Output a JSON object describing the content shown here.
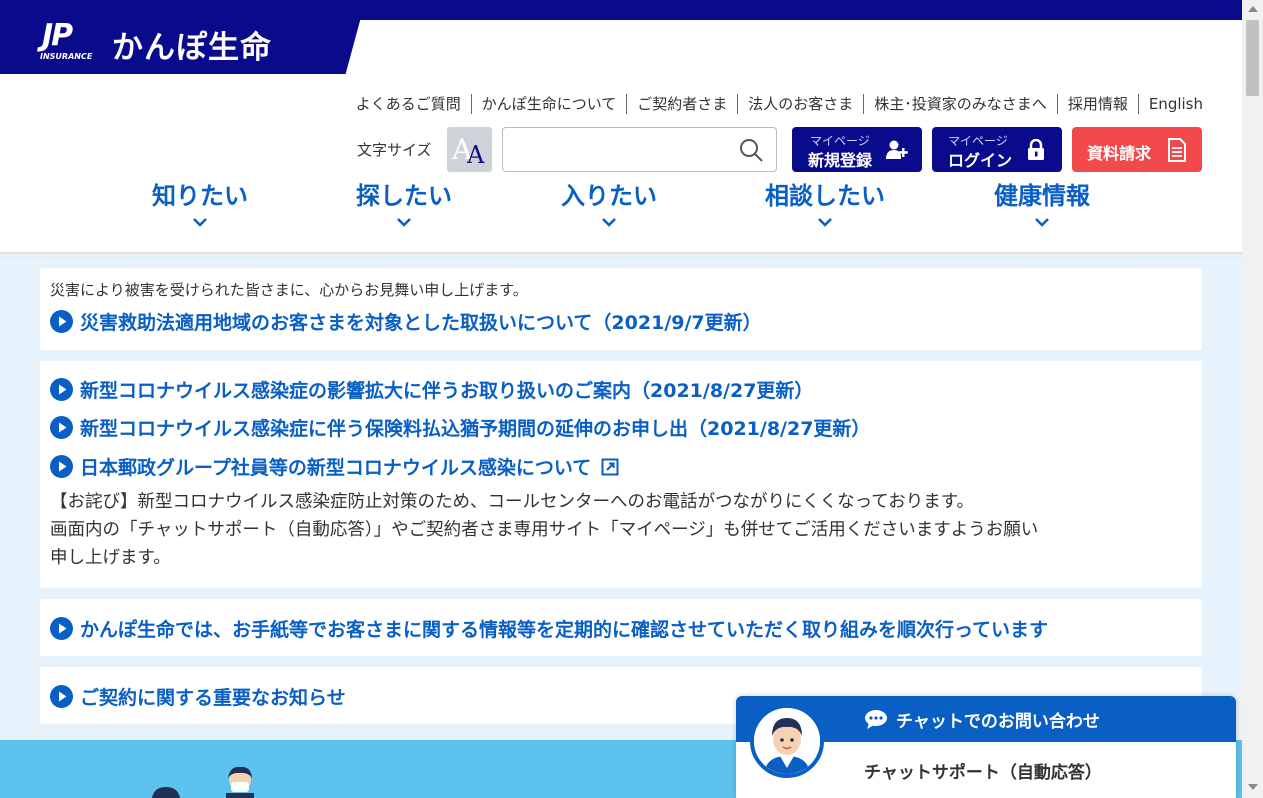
{
  "brand": {
    "logo_jp": "JP",
    "logo_sub": "INSURANCE",
    "name": "かんぽ生命"
  },
  "util_nav": [
    "よくあるご質問",
    "かんぽ生命について",
    "ご契約者さま",
    "法人のお客さま",
    "株主･投資家のみなさまへ",
    "採用情報",
    "English"
  ],
  "tools": {
    "font_size_label": "文字サイズ",
    "search_placeholder": "",
    "mypage_register_small": "マイページ",
    "mypage_register_main": "新規登録",
    "mypage_login_small": "マイページ",
    "mypage_login_main": "ログイン",
    "request_docs": "資料請求"
  },
  "main_nav": [
    "知りたい",
    "探したい",
    "入りたい",
    "相談したい",
    "健康情報"
  ],
  "notices": {
    "disaster_text": "災害により被害を受けられた皆さまに、心からお見舞い申し上げます。",
    "disaster_link": "災害救助法適用地域のお客さまを対象とした取扱いについて（2021/9/7更新）",
    "covid_link_1": "新型コロナウイルス感染症の影響拡大に伴うお取り扱いのご案内（2021/8/27更新）",
    "covid_link_2": "新型コロナウイルス感染症に伴う保険料払込猶予期間の延伸のお申し出（2021/8/27更新）",
    "covid_link_3": "日本郵政グループ社員等の新型コロナウイルス感染について",
    "apology_line_1": "【お詫び】新型コロナウイルス感染症防止対策のため、コールセンターへのお電話がつながりにくくなっております。",
    "apology_line_2": "画面内の「チャットサポート（自動応答）」やご契約者さま専用サイト「マイページ」も併せてご活用くださいますようお願い",
    "apology_line_3": "申し上げます。",
    "confirm_link": "かんぽ生命では、お手紙等でお客さまに関する情報等を定期的に確認させていただく取り組みを順次行っています",
    "important_link": "ご契約に関する重要なお知らせ"
  },
  "chat": {
    "title": "チャットでのお問い合わせ",
    "support": "チャットサポート（自動応答）"
  },
  "colors": {
    "brand_navy": "#0a0a8c",
    "link_blue": "#0a5fc4",
    "request_red": "#f24a4a",
    "notice_bg": "#e6f3fc"
  }
}
